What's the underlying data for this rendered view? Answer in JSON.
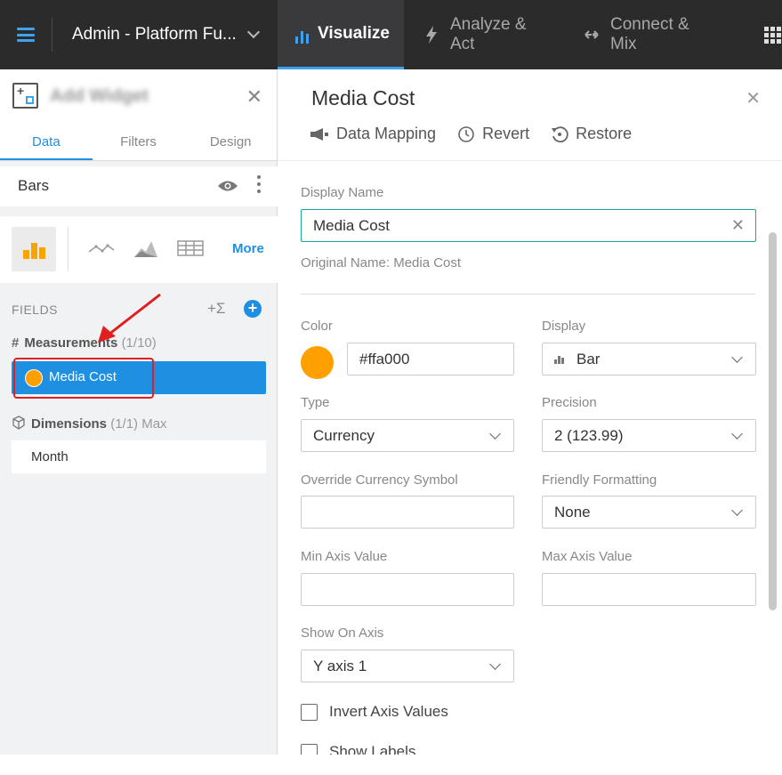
{
  "topbar": {
    "dashboard_title": "Admin - Platform Fu...",
    "tabs": [
      {
        "label": "Visualize",
        "icon": "bar-chart-icon",
        "active": true
      },
      {
        "label": "Analyze & Act",
        "icon": "lightning-icon",
        "active": false
      },
      {
        "label": "Connect & Mix",
        "icon": "connect-icon",
        "active": false
      }
    ]
  },
  "left_panel": {
    "title": "Add Widget",
    "tabs": [
      {
        "label": "Data",
        "active": true
      },
      {
        "label": "Filters",
        "active": false
      },
      {
        "label": "Design",
        "active": false
      }
    ],
    "chart_name": "Bars",
    "more_label": "More",
    "fields_label": "FIELDS",
    "sum_symbol": "+Σ",
    "measurements": {
      "label": "Measurements",
      "count": "(1/10)"
    },
    "measure_field": {
      "name": "Media Cost",
      "color": "#ffa000"
    },
    "dimensions": {
      "label": "Dimensions",
      "count": "(1/1)",
      "suffix": "Max"
    },
    "dimension_field": {
      "name": "Month"
    }
  },
  "right_panel": {
    "title": "Media Cost",
    "toolbar": {
      "data_mapping": "Data Mapping",
      "revert": "Revert",
      "restore": "Restore"
    },
    "display_name_label": "Display Name",
    "display_name_value": "Media Cost",
    "original_name": "Original Name: Media Cost",
    "color_label": "Color",
    "color_value": "#ffa000",
    "display_label": "Display",
    "display_value": "Bar",
    "type_label": "Type",
    "type_value": "Currency",
    "precision_label": "Precision",
    "precision_value": "2 (123.99)",
    "override_currency_label": "Override Currency Symbol",
    "override_currency_value": "",
    "friendly_label": "Friendly Formatting",
    "friendly_value": "None",
    "min_axis_label": "Min Axis Value",
    "min_axis_value": "",
    "max_axis_label": "Max Axis Value",
    "max_axis_value": "",
    "show_on_axis_label": "Show On Axis",
    "show_on_axis_value": "Y axis 1",
    "invert_axis_label": "Invert Axis Values",
    "invert_axis_checked": false,
    "show_labels_label": "Show Labels",
    "show_labels_checked": false
  },
  "colors": {
    "accent": "#1e8fe1",
    "measure": "#ffa000",
    "topbar": "#2b2b2c",
    "annotation": "#e02020"
  }
}
